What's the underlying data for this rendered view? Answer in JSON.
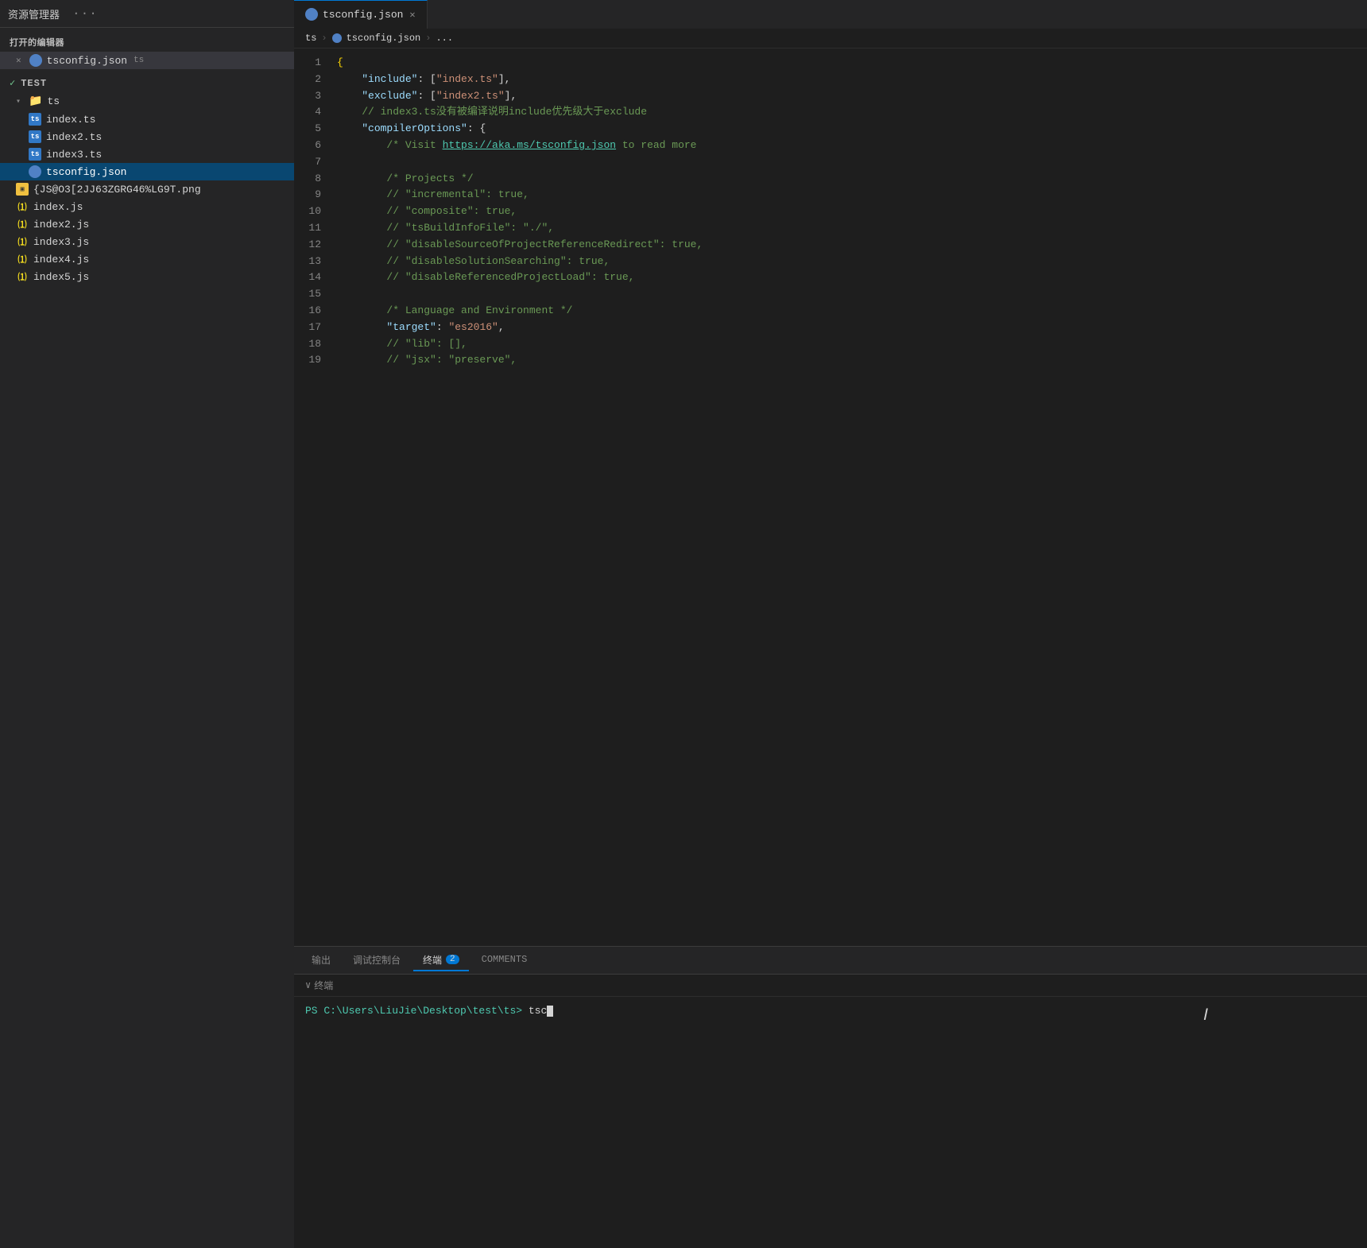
{
  "sidebar": {
    "title": "资源管理器",
    "title_dots": "···",
    "open_editors_label": "打开的编辑器",
    "open_editors": [
      {
        "name": "tsconfig.json",
        "lang": "ts",
        "type": "json",
        "active": true
      }
    ],
    "tree": {
      "root_label": "TEST",
      "folder": {
        "name": "ts",
        "items": [
          {
            "name": "index.ts",
            "type": "ts"
          },
          {
            "name": "index2.ts",
            "type": "ts"
          },
          {
            "name": "index3.ts",
            "type": "ts"
          },
          {
            "name": "tsconfig.json",
            "type": "json",
            "active": true
          }
        ]
      },
      "other_items": [
        {
          "name": "{JS@O3[2JJ63ZGRG46%LG9T.png",
          "type": "png"
        },
        {
          "name": "index.js",
          "type": "js"
        },
        {
          "name": "index2.js",
          "type": "js"
        },
        {
          "name": "index3.js",
          "type": "js"
        },
        {
          "name": "index4.js",
          "type": "js"
        },
        {
          "name": "index5.js",
          "type": "js"
        }
      ]
    }
  },
  "editor": {
    "tab_label": "tsconfig.json",
    "tab_lang": "ts",
    "breadcrumb": {
      "parts": [
        "ts",
        "tsconfig.json",
        "..."
      ]
    },
    "lines": [
      {
        "num": 1,
        "tokens": [
          {
            "t": "{",
            "c": "c-bracket"
          }
        ]
      },
      {
        "num": 2,
        "tokens": [
          {
            "t": "    ",
            "c": ""
          },
          {
            "t": "\"include\"",
            "c": "c-key"
          },
          {
            "t": ": [",
            "c": "c-punct"
          },
          {
            "t": "\"index.ts\"",
            "c": "c-str"
          },
          {
            "t": "],",
            "c": "c-punct"
          }
        ]
      },
      {
        "num": 3,
        "tokens": [
          {
            "t": "    ",
            "c": ""
          },
          {
            "t": "\"exclude\"",
            "c": "c-key"
          },
          {
            "t": ": [",
            "c": "c-punct"
          },
          {
            "t": "\"index2.ts\"",
            "c": "c-str"
          },
          {
            "t": "],",
            "c": "c-punct"
          }
        ]
      },
      {
        "num": 4,
        "tokens": [
          {
            "t": "    // index3.ts没有被编译说明include优先级大于exclude",
            "c": "c-comment"
          }
        ]
      },
      {
        "num": 5,
        "tokens": [
          {
            "t": "    ",
            "c": ""
          },
          {
            "t": "\"compilerOptions\"",
            "c": "c-key"
          },
          {
            "t": ": {",
            "c": "c-punct"
          }
        ]
      },
      {
        "num": 6,
        "tokens": [
          {
            "t": "        /* Visit ",
            "c": "c-comment"
          },
          {
            "t": "https://aka.ms/tsconfig.json",
            "c": "c-link"
          },
          {
            "t": " to read more",
            "c": "c-comment"
          }
        ]
      },
      {
        "num": 7,
        "tokens": [
          {
            "t": "",
            "c": ""
          }
        ]
      },
      {
        "num": 8,
        "tokens": [
          {
            "t": "        /* Projects */",
            "c": "c-comment"
          }
        ]
      },
      {
        "num": 9,
        "tokens": [
          {
            "t": "        // \"incremental\": true,",
            "c": "c-comment"
          }
        ]
      },
      {
        "num": 10,
        "tokens": [
          {
            "t": "        // \"composite\": true,",
            "c": "c-comment"
          }
        ]
      },
      {
        "num": 11,
        "tokens": [
          {
            "t": "        // \"tsBuildInfoFile\": \"./\",",
            "c": "c-comment"
          }
        ]
      },
      {
        "num": 12,
        "tokens": [
          {
            "t": "        // \"disableSourceOfProjectReferenceRedirect\": true,",
            "c": "c-comment"
          }
        ]
      },
      {
        "num": 13,
        "tokens": [
          {
            "t": "        // \"disableSolutionSearching\": true,",
            "c": "c-comment"
          }
        ]
      },
      {
        "num": 14,
        "tokens": [
          {
            "t": "        // \"disableReferencedProjectLoad\": true,",
            "c": "c-comment"
          }
        ]
      },
      {
        "num": 15,
        "tokens": [
          {
            "t": "",
            "c": ""
          }
        ]
      },
      {
        "num": 16,
        "tokens": [
          {
            "t": "        /* Language and Environment */",
            "c": "c-comment"
          }
        ]
      },
      {
        "num": 17,
        "tokens": [
          {
            "t": "        ",
            "c": ""
          },
          {
            "t": "\"target\"",
            "c": "c-key"
          },
          {
            "t": ": ",
            "c": "c-punct"
          },
          {
            "t": "\"es2016\"",
            "c": "c-str"
          },
          {
            "t": ",",
            "c": "c-punct"
          }
        ]
      },
      {
        "num": 18,
        "tokens": [
          {
            "t": "        // \"lib\": [],",
            "c": "c-comment"
          }
        ]
      },
      {
        "num": 19,
        "tokens": [
          {
            "t": "        // \"jsx\": \"preserve\",",
            "c": "c-comment"
          }
        ]
      }
    ]
  },
  "panel": {
    "tabs": [
      {
        "label": "输出",
        "active": false,
        "badge": null
      },
      {
        "label": "调试控制台",
        "active": false,
        "badge": null
      },
      {
        "label": "终端",
        "active": true,
        "badge": "2"
      },
      {
        "label": "COMMENTS",
        "active": false,
        "badge": null
      }
    ],
    "terminal": {
      "section_label": "终端",
      "prompt": "PS C:\\Users\\LiuJie\\Desktop\\test\\ts>",
      "command": " tsc"
    }
  }
}
